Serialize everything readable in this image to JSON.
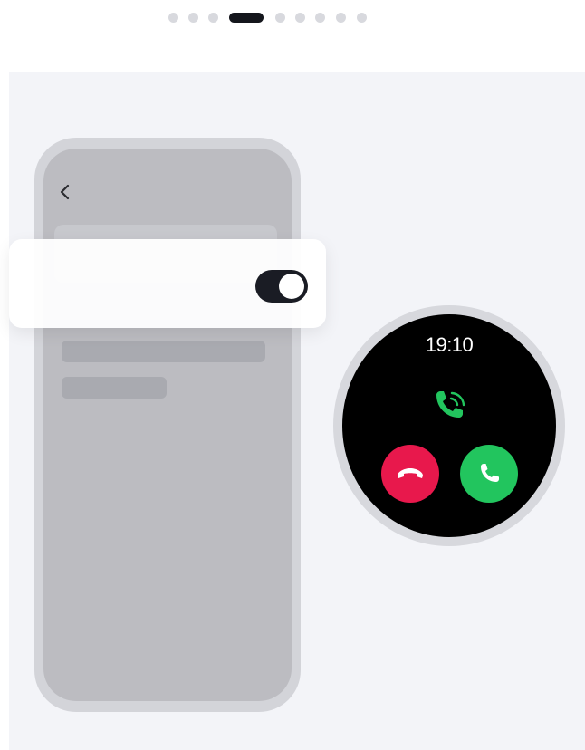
{
  "pager": {
    "total_pages": 9,
    "current_page": 4
  },
  "watch": {
    "time": "19:10"
  },
  "colors": {
    "panel_bg": "#f3f4f8",
    "toggle_on": "#1a1c24",
    "decline": "#e8184c",
    "accept": "#22c55e",
    "incoming_icon": "#22c55e"
  },
  "icons": {
    "back": "chevron-left-icon",
    "incoming": "incoming-call-icon",
    "decline": "phone-hangup-icon",
    "accept": "phone-icon"
  },
  "setting": {
    "toggle_state": "on"
  }
}
